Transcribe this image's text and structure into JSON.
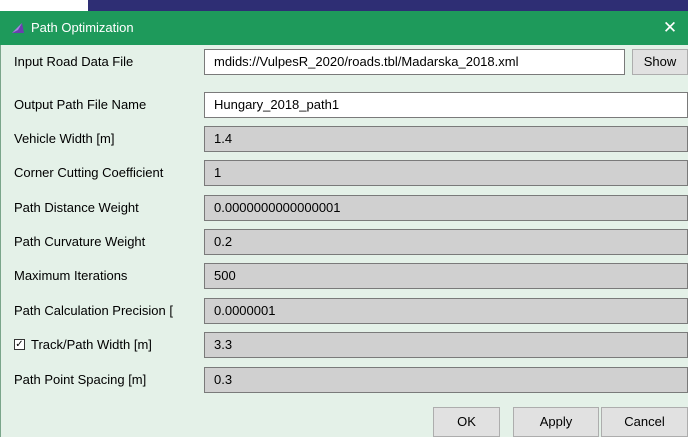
{
  "window": {
    "title": "Path Optimization",
    "close_glyph": "✕",
    "app_icon": "purple-app-icon"
  },
  "fields": [
    {
      "label": "Input Road Data File",
      "value": "mdids://VulpesR_2020/roads.tbl/Madarska_2018.xml",
      "editable": true
    },
    {
      "label": "Output Path File Name",
      "value": "Hungary_2018_path1",
      "editable": true
    },
    {
      "label": "Vehicle Width [m]",
      "value": "1.4",
      "editable": false
    },
    {
      "label": "Corner Cutting Coefficient",
      "value": "1",
      "editable": false
    },
    {
      "label": "Path Distance Weight",
      "value": "0.0000000000000001",
      "editable": false
    },
    {
      "label": "Path Curvature Weight",
      "value": "0.2",
      "editable": false
    },
    {
      "label": "Maximum Iterations",
      "value": "500",
      "editable": false
    },
    {
      "label": "Path Calculation Precision [",
      "value": "0.0000001",
      "editable": false
    },
    {
      "label": "Track/Path Width [m]",
      "value": "3.3",
      "editable": false,
      "checked": true
    },
    {
      "label": "Path Point Spacing [m]",
      "value": "0.3",
      "editable": false
    }
  ],
  "buttons": {
    "show": "Show",
    "ok": "OK",
    "apply": "Apply",
    "cancel": "Cancel"
  },
  "colors": {
    "titlebar": "#1e9a5b",
    "dialog_bg": "#e4f1e8",
    "disabled_field": "#d0d0d0"
  }
}
